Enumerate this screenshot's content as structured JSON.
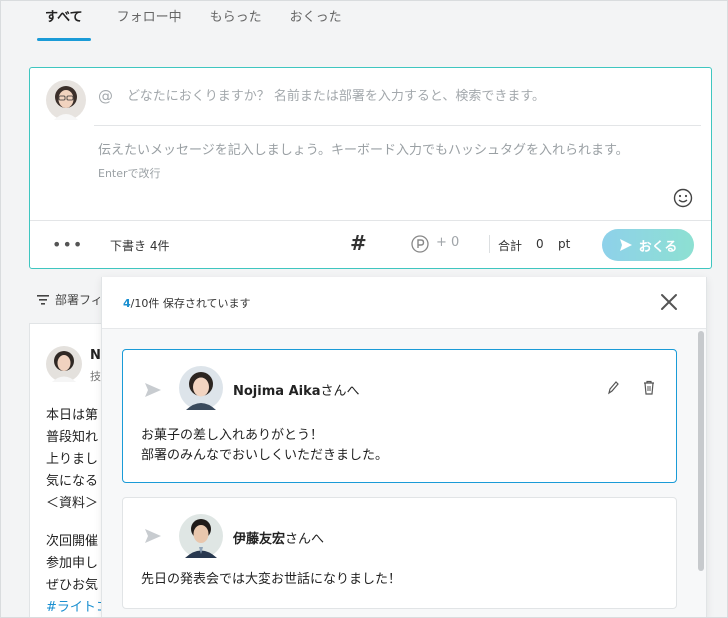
{
  "tabs": [
    {
      "label": "すべて",
      "active": true
    },
    {
      "label": "フォロー中",
      "active": false
    },
    {
      "label": "もらった",
      "active": false
    },
    {
      "label": "おくった",
      "active": false
    }
  ],
  "compose": {
    "to_placeholder": "どなたにおくりますか？ 名前または部署を入力すると、検索できます。",
    "message_placeholder": "伝えたいメッセージを記入しましょう。キーボード入力でもハッシュタグを入れられます。",
    "enter_hint": "Enterで改行",
    "drafts_label": "下書き 4件",
    "points_plus": "+ 0",
    "total_label": "合計",
    "total_value": "0",
    "total_unit": "pt",
    "send_label": "おくる",
    "accent_color": "#3fc6c0"
  },
  "feed": {
    "filter_label": "部署フィ",
    "card": {
      "name": "No",
      "sub": "技",
      "lines": [
        "本日は第",
        "普段知れ",
        "上りまし",
        "気になる",
        "＜資料＞",
        "",
        "次回開催",
        "参加申し",
        "ぜひお気",
        "#ライトコ"
      ]
    }
  },
  "drafts_popover": {
    "count_current": "4",
    "count_rest": "/10件 保存されています",
    "items": [
      {
        "recipient_name": "Nojima Aika",
        "recipient_suffix": "さんへ",
        "lines": [
          "お菓子の差し入れありがとう！",
          "部署のみんなでおいしくいただきました。"
        ],
        "selected": true
      },
      {
        "recipient_name": "伊藤友宏",
        "recipient_suffix": "さんへ",
        "lines": [
          "先日の発表会では大変お世話になりました！"
        ],
        "selected": false
      }
    ]
  }
}
